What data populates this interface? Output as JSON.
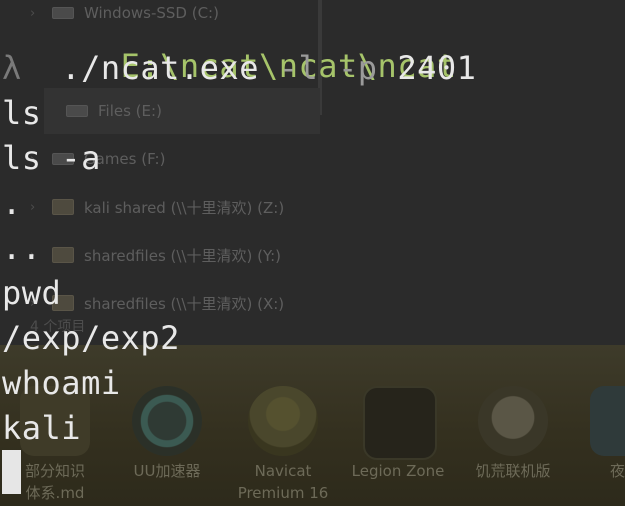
{
  "terminal": {
    "path": "E:\\ncat\\ncat\\ncat",
    "prompt_symbol": "λ",
    "command": "./ncat.exe",
    "flag_listen": "-l",
    "flag_port": "-p",
    "port": "2401",
    "lines": [
      "ls",
      "ls -a",
      ".",
      "..",
      "pwd",
      "/exp/exp2",
      "whoami",
      "kali"
    ]
  },
  "explorer": {
    "items": [
      {
        "label": "Windows-SSD (C:)",
        "icon": "drive-icon"
      },
      {
        "label": "Files (E:)",
        "icon": "drive-icon"
      },
      {
        "label": "Games (F:)",
        "icon": "drive-icon"
      },
      {
        "label": "kali shared (\\\\十里清欢) (Z:)",
        "icon": "network-drive-icon"
      },
      {
        "label": "sharedfiles (\\\\十里清欢) (Y:)",
        "icon": "network-drive-icon"
      },
      {
        "label": "sharedfiles (\\\\十里清欢) (X:)",
        "icon": "network-drive-icon"
      }
    ],
    "status": "4 个项目"
  },
  "desktop": {
    "icons": [
      {
        "label": "部分知识",
        "sublabel": "体系.md",
        "icon": "markdown-file-icon"
      },
      {
        "label": "UU加速器",
        "sublabel": "",
        "icon": "uu-accelerator-icon"
      },
      {
        "label": "Navicat",
        "sublabel": "Premium 16",
        "icon": "navicat-icon"
      },
      {
        "label": "Legion Zone",
        "sublabel": "",
        "icon": "legion-zone-icon"
      },
      {
        "label": "饥荒联机版",
        "sublabel": "",
        "icon": "dont-starve-icon"
      },
      {
        "label": "夜雨",
        "sublabel": "",
        "icon": "app-icon"
      }
    ]
  }
}
